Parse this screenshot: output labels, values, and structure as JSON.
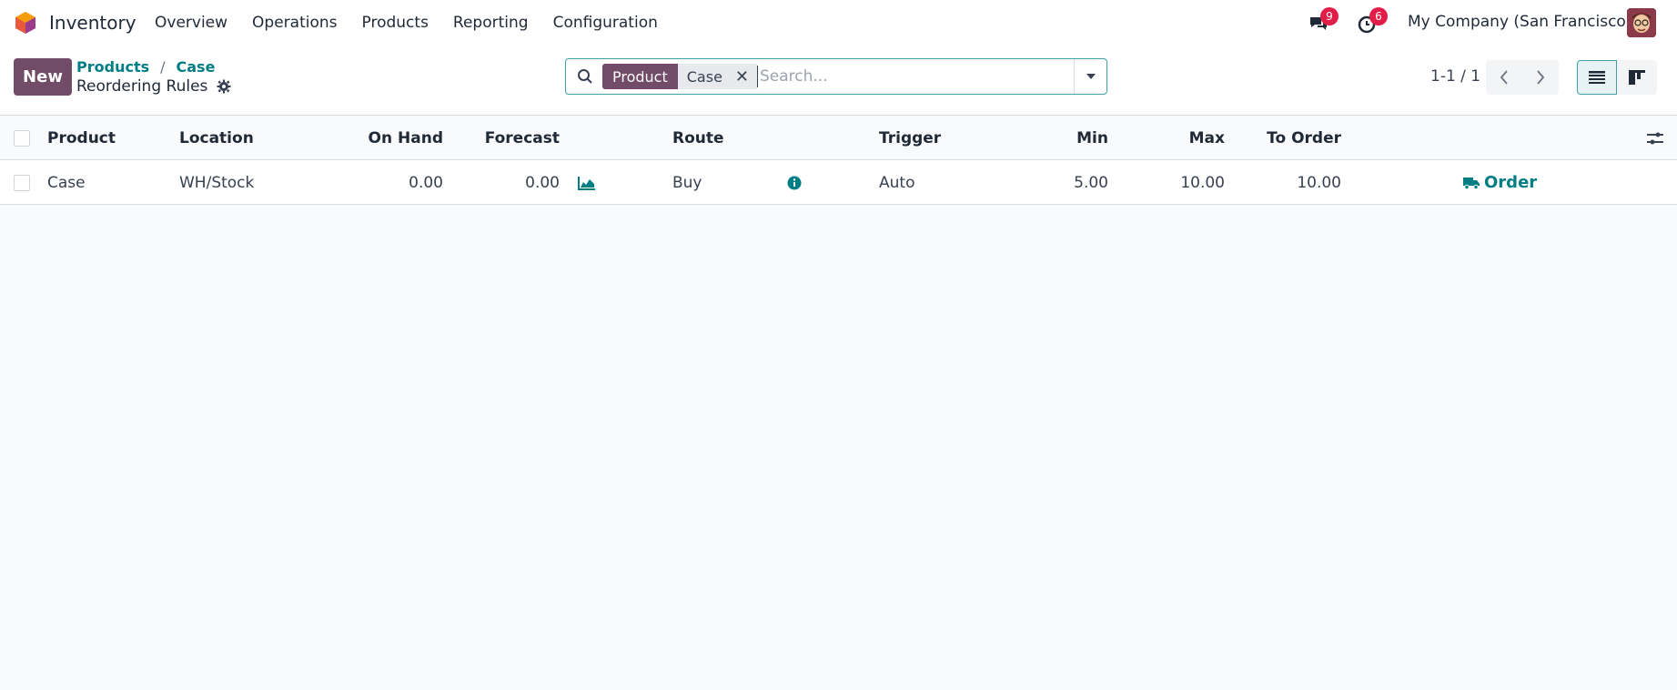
{
  "navbar": {
    "app_name": "Inventory",
    "menu": [
      "Overview",
      "Operations",
      "Products",
      "Reporting",
      "Configuration"
    ],
    "messages_count": "9",
    "activities_count": "6",
    "company": "My Company (San Francisco)"
  },
  "control": {
    "new_label": "New",
    "breadcrumb": [
      "Products",
      "Case"
    ],
    "breadcrumb_sep": "/",
    "title": "Reordering Rules",
    "search": {
      "facet_label": "Product",
      "facet_value": "Case",
      "placeholder": "Search..."
    },
    "pager": "1-1 / 1"
  },
  "table": {
    "headers": {
      "product": "Product",
      "location": "Location",
      "on_hand": "On Hand",
      "forecast": "Forecast",
      "route": "Route",
      "trigger": "Trigger",
      "min": "Min",
      "max": "Max",
      "to_order": "To Order"
    },
    "rows": [
      {
        "product": "Case",
        "location": "WH/Stock",
        "on_hand": "0.00",
        "forecast": "0.00",
        "route": "Buy",
        "trigger": "Auto",
        "min": "5.00",
        "max": "10.00",
        "to_order": "10.00",
        "action": "Order"
      }
    ]
  },
  "colors": {
    "brand": "#714b67",
    "accent": "#017e84",
    "badge": "#e11d48"
  }
}
